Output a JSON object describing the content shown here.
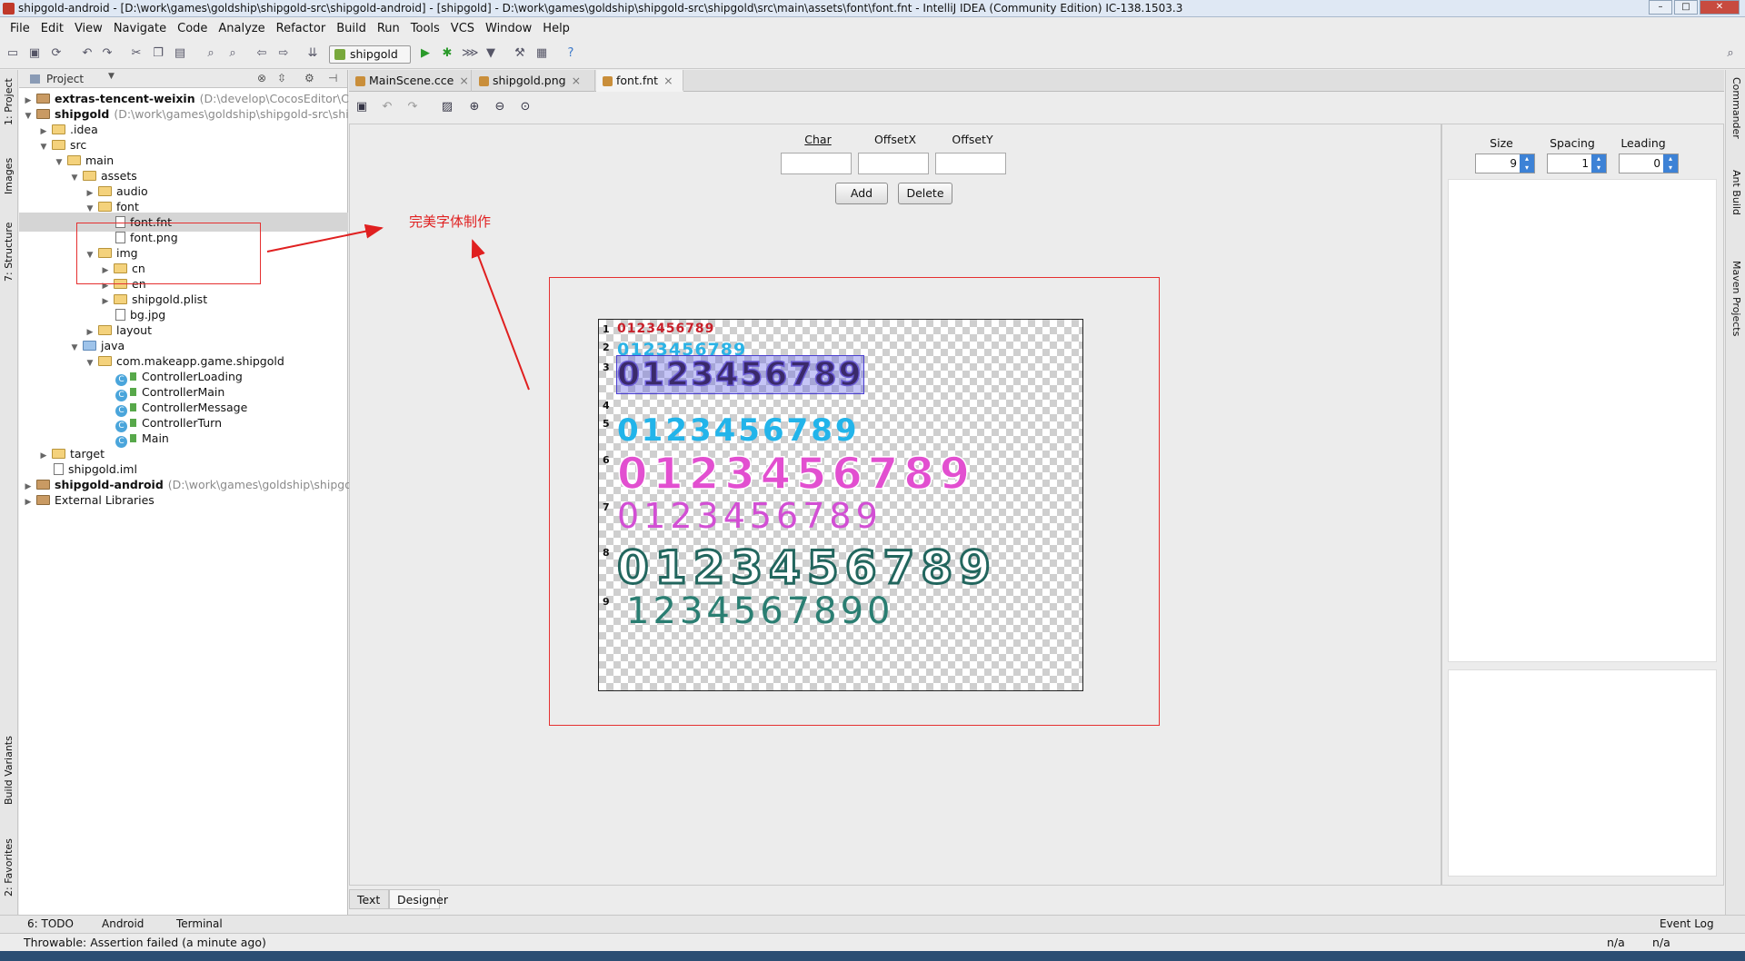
{
  "window": {
    "title": "shipgold-android - [D:\\work\\games\\goldship\\shipgold-src\\shipgold-android] - [shipgold] - D:\\work\\games\\goldship\\shipgold-src\\shipgold\\src\\main\\assets\\font\\font.fnt - IntelliJ IDEA (Community Edition) IC-138.1503.3"
  },
  "menu": [
    "File",
    "Edit",
    "View",
    "Navigate",
    "Code",
    "Analyze",
    "Refactor",
    "Build",
    "Run",
    "Tools",
    "VCS",
    "Window",
    "Help"
  ],
  "toolbar": {
    "run_config": "shipgold"
  },
  "left_tool_tabs": [
    "1: Project",
    "Images",
    "7: Structure",
    "Build Variants",
    "2: Favorites"
  ],
  "right_tool_tabs": [
    "Commander",
    "Ant Build",
    "Maven Projects"
  ],
  "project_panel": {
    "selector": "Project"
  },
  "tree": [
    {
      "depth": 0,
      "arrow": "▶",
      "icon": "brown",
      "name": "extras-tencent-weixin",
      "hint": "(D:\\develop\\CocosEditor\\Cocos",
      "bold": true
    },
    {
      "depth": 0,
      "arrow": "▼",
      "icon": "brown",
      "name": "shipgold",
      "hint": "(D:\\work\\games\\goldship\\shipgold-src\\shipg",
      "bold": true
    },
    {
      "depth": 1,
      "arrow": "▶",
      "icon": "folder",
      "name": ".idea"
    },
    {
      "depth": 1,
      "arrow": "▼",
      "icon": "folder",
      "name": "src"
    },
    {
      "depth": 2,
      "arrow": "▼",
      "icon": "folder",
      "name": "main"
    },
    {
      "depth": 3,
      "arrow": "▼",
      "icon": "folder",
      "name": "assets"
    },
    {
      "depth": 4,
      "arrow": "▶",
      "icon": "folder",
      "name": "audio"
    },
    {
      "depth": 4,
      "arrow": "▼",
      "icon": "folder",
      "name": "font"
    },
    {
      "depth": 5,
      "arrow": "",
      "icon": "file",
      "name": "font.fnt",
      "selected": true
    },
    {
      "depth": 5,
      "arrow": "",
      "icon": "file",
      "name": "font.png"
    },
    {
      "depth": 4,
      "arrow": "▼",
      "icon": "folder",
      "name": "img"
    },
    {
      "depth": 5,
      "arrow": "▶",
      "icon": "folder",
      "name": "cn"
    },
    {
      "depth": 5,
      "arrow": "▶",
      "icon": "folder",
      "name": "en"
    },
    {
      "depth": 5,
      "arrow": "▶",
      "icon": "folder",
      "name": "shipgold.plist"
    },
    {
      "depth": 5,
      "arrow": "",
      "icon": "file",
      "name": "bg.jpg"
    },
    {
      "depth": 4,
      "arrow": "▶",
      "icon": "folder",
      "name": "layout"
    },
    {
      "depth": 3,
      "arrow": "▼",
      "icon": "blue",
      "name": "java"
    },
    {
      "depth": 4,
      "arrow": "▼",
      "icon": "folder",
      "name": "com.makeapp.game.shipgold"
    },
    {
      "depth": 5,
      "arrow": "",
      "icon": "class",
      "name": "ControllerLoading"
    },
    {
      "depth": 5,
      "arrow": "",
      "icon": "class",
      "name": "ControllerMain"
    },
    {
      "depth": 5,
      "arrow": "",
      "icon": "class",
      "name": "ControllerMessage"
    },
    {
      "depth": 5,
      "arrow": "",
      "icon": "class",
      "name": "ControllerTurn"
    },
    {
      "depth": 5,
      "arrow": "",
      "icon": "class",
      "name": "Main"
    },
    {
      "depth": 1,
      "arrow": "▶",
      "icon": "folder",
      "name": "target"
    },
    {
      "depth": 1,
      "arrow": "",
      "icon": "file",
      "name": "shipgold.iml"
    },
    {
      "depth": 0,
      "arrow": "▶",
      "icon": "brown",
      "name": "shipgold-android",
      "hint": "(D:\\work\\games\\goldship\\shipgold-",
      "bold": true
    },
    {
      "depth": 0,
      "arrow": "▶",
      "icon": "lib",
      "name": "External Libraries"
    }
  ],
  "editor_tabs": [
    {
      "label": "MainScene.cce",
      "close": "×"
    },
    {
      "label": "shipgold.png",
      "close": "×"
    },
    {
      "label": "font.fnt",
      "close": "×",
      "active": true
    }
  ],
  "designer": {
    "char_label": "Char",
    "offsetx_label": "OffsetX",
    "offsety_label": "OffsetY",
    "add_button": "Add",
    "delete_button": "Delete",
    "annotation": "完美字体制作",
    "rows": [
      {
        "num": "1",
        "text": "0123456789",
        "color": "#c8202a"
      },
      {
        "num": "2",
        "text": "0123456789",
        "color": "#2bb3e6"
      },
      {
        "num": "3",
        "text": "0123456789",
        "color": "#3a2a6a"
      },
      {
        "num": "4",
        "text": "",
        "color": "#ffffff"
      },
      {
        "num": "5",
        "text": "0123456789",
        "color": "#22b4ea"
      },
      {
        "num": "6",
        "text": "0123456789",
        "color": "#e24fd0"
      },
      {
        "num": "7",
        "text": "0123456789",
        "color": "#d24fd4"
      },
      {
        "num": "8",
        "text": "0123456789",
        "color": "#ffffff"
      },
      {
        "num": "9",
        "text": "1234567890",
        "color": "#2a7e72"
      }
    ]
  },
  "side_panel": {
    "size_label": "Size",
    "spacing_label": "Spacing",
    "leading_label": "Leading",
    "size": "9",
    "spacing": "1",
    "leading": "0"
  },
  "bottom_tabs": [
    "Text",
    "Designer"
  ],
  "status_tabs": [
    "6: TODO",
    "Android",
    "Terminal"
  ],
  "event_log": "Event Log",
  "status_message": "Throwable: Assertion failed (a minute ago)",
  "status_right": [
    "n/a",
    "n/a"
  ]
}
